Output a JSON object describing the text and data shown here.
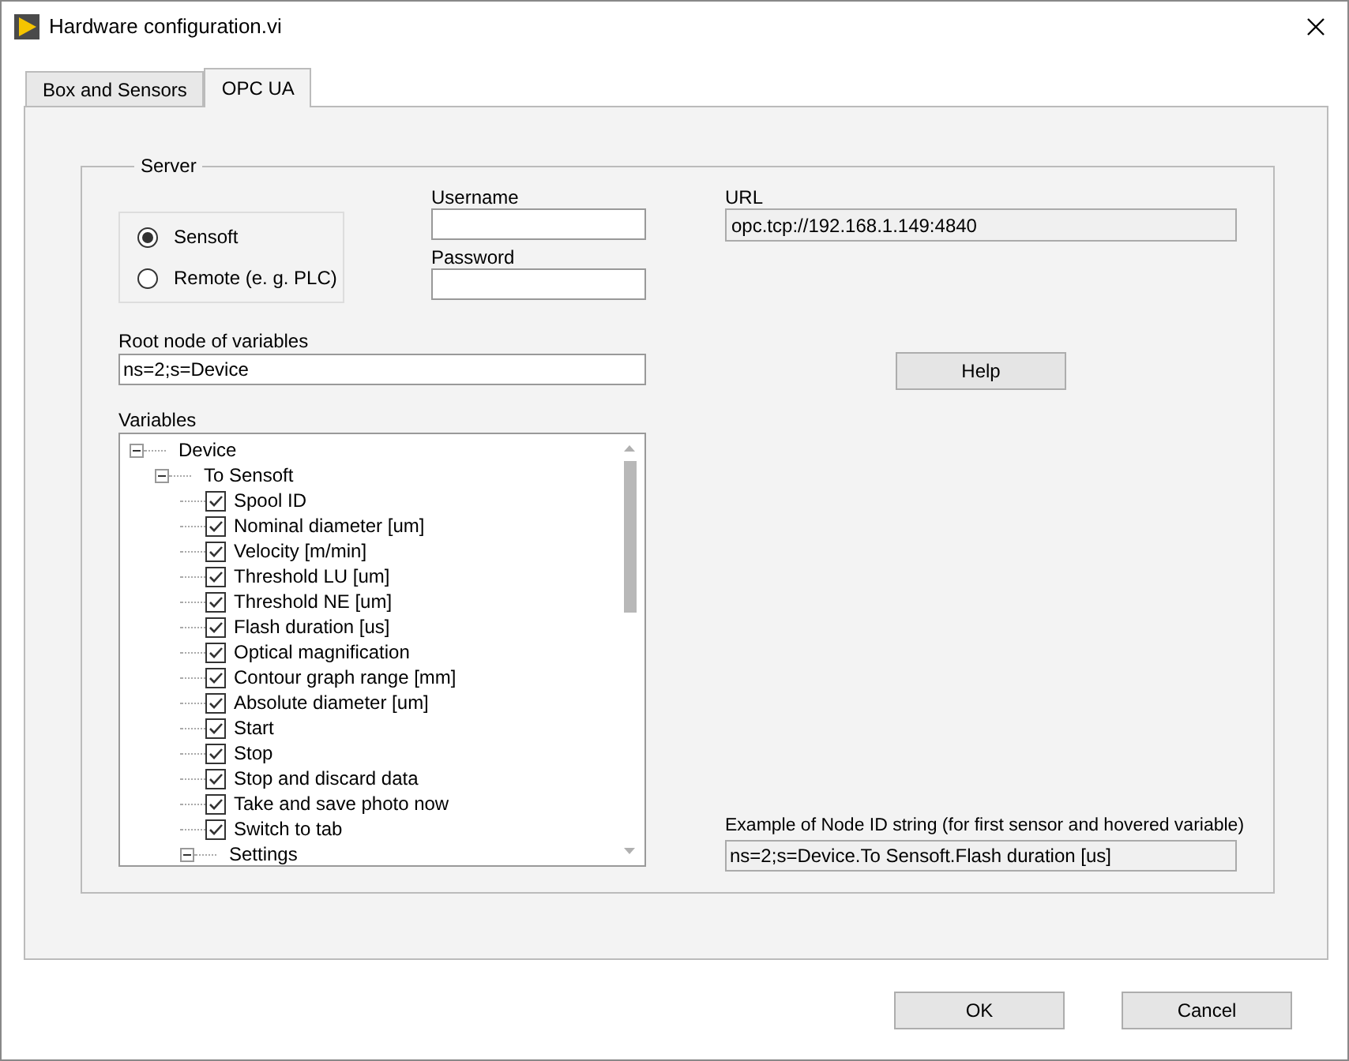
{
  "window": {
    "title": "Hardware configuration.vi"
  },
  "tabs": [
    {
      "label": "Box and Sensors",
      "selected": false
    },
    {
      "label": "OPC UA",
      "selected": true
    }
  ],
  "server": {
    "title": "Server",
    "modes": [
      {
        "label": "Sensoft",
        "selected": true
      },
      {
        "label": "Remote (e. g. PLC)",
        "selected": false
      }
    ],
    "username": {
      "label": "Username"
    },
    "password": {
      "label": "Password"
    },
    "url": {
      "label": "URL",
      "value": "opc.tcp://192.168.1.149:4840"
    },
    "root_node": {
      "label": "Root node of variables",
      "value": "ns=2;s=Device"
    },
    "help_button": "Help",
    "variables": {
      "label": "Variables",
      "tree": [
        {
          "label": "Device",
          "expanded": true,
          "children": [
            {
              "label": "To Sensoft",
              "expanded": true,
              "children": [
                {
                  "label": "Spool ID",
                  "checked": true
                },
                {
                  "label": "Nominal diameter [um]",
                  "checked": true
                },
                {
                  "label": "Velocity [m/min]",
                  "checked": true
                },
                {
                  "label": "Threshold LU [um]",
                  "checked": true
                },
                {
                  "label": "Threshold NE [um]",
                  "checked": true
                },
                {
                  "label": "Flash duration [us]",
                  "checked": true
                },
                {
                  "label": "Optical magnification",
                  "checked": true
                },
                {
                  "label": "Contour graph range [mm]",
                  "checked": true
                },
                {
                  "label": "Absolute diameter [um]",
                  "checked": true
                },
                {
                  "label": "Start",
                  "checked": true
                },
                {
                  "label": "Stop",
                  "checked": true
                },
                {
                  "label": "Stop and discard data",
                  "checked": true
                },
                {
                  "label": "Take and save photo now",
                  "checked": true
                },
                {
                  "label": "Switch to tab",
                  "checked": true
                },
                {
                  "label": "Settings",
                  "expanded": true
                }
              ]
            }
          ]
        }
      ]
    },
    "example": {
      "label": "Example of Node ID string (for first sensor and hovered variable)",
      "value": "ns=2;s=Device.To Sensoft.Flash duration [us]"
    }
  },
  "buttons": [
    "OK",
    "Cancel"
  ]
}
